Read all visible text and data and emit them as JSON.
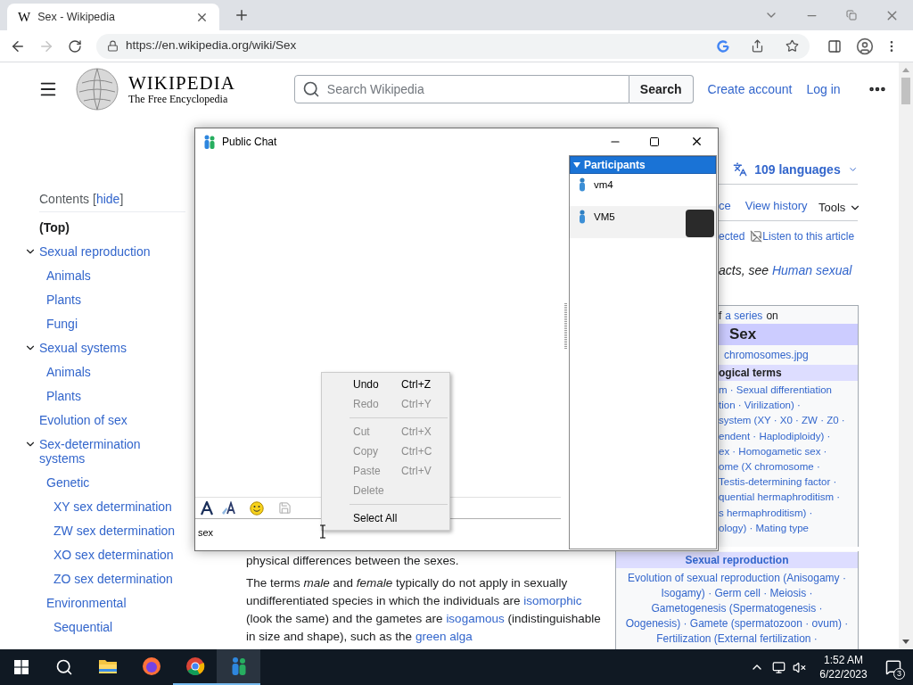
{
  "browser": {
    "tab": {
      "favicon": "W",
      "title": "Sex - Wikipedia",
      "selected": true
    },
    "nav": [
      {
        "kind": "back",
        "disabled": false
      },
      {
        "kind": "forward",
        "disabled": true
      },
      {
        "kind": "reload",
        "disabled": false
      }
    ],
    "url": "https://en.wikipedia.org/wiki/Sex"
  },
  "wiki_header": {
    "wordmark": "WIKIPEDIA",
    "tagline": "The Free Encyclopedia",
    "search_placeholder": "Search Wikipedia",
    "search_button": "Search",
    "links": [
      "Create account",
      "Log in"
    ]
  },
  "toc": {
    "title": "Contents",
    "toggle_open": "[",
    "toggle_label": "hide",
    "toggle_close": "]",
    "items": [
      {
        "label": "(Top)",
        "selected": true
      },
      {
        "label": "Sexual reproduction",
        "selected": false,
        "expanded": true,
        "children": [
          {
            "label": "Animals",
            "selected": false
          },
          {
            "label": "Plants",
            "selected": false
          },
          {
            "label": "Fungi",
            "selected": false
          }
        ]
      },
      {
        "label": "Sexual systems",
        "selected": false,
        "expanded": true,
        "children": [
          {
            "label": "Animals",
            "selected": false
          },
          {
            "label": "Plants",
            "selected": false
          }
        ]
      },
      {
        "label": "Evolution of sex",
        "selected": false
      },
      {
        "label": "Sex-determination systems",
        "selected": false,
        "expanded": true,
        "children": [
          {
            "label": "Genetic",
            "selected": false,
            "children": [
              {
                "label": "XY sex determination",
                "selected": false
              },
              {
                "label": "ZW sex determination",
                "selected": false
              },
              {
                "label": "XO sex determination",
                "selected": false
              },
              {
                "label": "ZO sex determination",
                "selected": false
              }
            ]
          },
          {
            "label": "Environmental",
            "selected": false,
            "children": [
              {
                "label": "Sequential",
                "selected": false
              }
            ]
          }
        ]
      }
    ]
  },
  "page_tools": {
    "languages": "109 languages",
    "tabs": [
      "ce",
      "View history"
    ],
    "tools": "Tools",
    "indicator": "ected",
    "listen": "Listen to this article",
    "hatnote_text": "acts, see ",
    "hatnote_link": "Human sexual"
  },
  "infobox": {
    "series_prefix": "f",
    "series_link": "a series",
    "series_suffix": "on",
    "title": "Sex",
    "image_caption": "chromosomes.jpg",
    "sections": [
      {
        "heading": "ogical terms",
        "lines": [
          "m · Sexual differentiation",
          "tion · Virilization) ·",
          "system (XY · X0 · ZW · Z0 ·",
          "endent · Haplodiploidy) ·",
          "ex · Homogametic sex ·",
          "ome (X chromosome ·",
          "Testis-determining factor ·",
          "quential hermaphroditism ·",
          "s hermaphroditism) ·",
          "ology) · Mating type"
        ]
      },
      {
        "heading": "Sexual reproduction",
        "lines": [
          "Evolution of sexual reproduction (Anisogamy ·",
          "Isogamy) · Germ cell · Meiosis ·",
          "Gametogenesis (Spermatogenesis ·",
          "Oogenesis) · Gamete (spermatozoon · ovum) ·",
          "Fertilization (External fertilization ·"
        ]
      }
    ]
  },
  "article": {
    "paragraphs": [
      [
        {
          "text": "physical differences between the sexes.",
          "link": false
        }
      ],
      [
        {
          "text": "The terms *male* and *female* typically do not apply in sexually undifferentiated species in which the individuals are ",
          "link": false
        },
        {
          "text": "isomorphic",
          "link": true
        },
        {
          "text": " (look the same) and the gametes are ",
          "link": false
        },
        {
          "text": "isogamous",
          "link": true
        },
        {
          "text": " (indistinguishable in size and shape), such as the ",
          "link": false
        },
        {
          "text": "green alga",
          "link": true
        }
      ]
    ]
  },
  "chat": {
    "title": "Public Chat",
    "participants_header": "Participants",
    "participants_expanded": true,
    "participants": [
      {
        "name": "vm4",
        "selected": false,
        "avatar": false
      },
      {
        "name": "VM5",
        "selected": true,
        "avatar": true
      }
    ],
    "toolbar": [
      {
        "kind": "font",
        "disabled": false
      },
      {
        "kind": "color",
        "disabled": false
      },
      {
        "kind": "emoji",
        "disabled": false
      },
      {
        "kind": "save",
        "disabled": true
      }
    ],
    "input_value": "sex",
    "context_menu": [
      {
        "kind": "item",
        "label": "Undo",
        "shortcut": "Ctrl+Z",
        "disabled": false
      },
      {
        "kind": "item",
        "label": "Redo",
        "shortcut": "Ctrl+Y",
        "disabled": true
      },
      {
        "kind": "separator"
      },
      {
        "kind": "item",
        "label": "Cut",
        "shortcut": "Ctrl+X",
        "disabled": true
      },
      {
        "kind": "item",
        "label": "Copy",
        "shortcut": "Ctrl+C",
        "disabled": true
      },
      {
        "kind": "item",
        "label": "Paste",
        "shortcut": "Ctrl+V",
        "disabled": true
      },
      {
        "kind": "item",
        "label": "Delete",
        "disabled": true
      },
      {
        "kind": "separator"
      },
      {
        "kind": "item",
        "label": "Select All",
        "disabled": false
      }
    ]
  },
  "taskbar": {
    "apps": [
      {
        "kind": "explorer",
        "running": false,
        "active": false
      },
      {
        "kind": "firefox",
        "running": false,
        "active": false
      },
      {
        "kind": "chrome",
        "running": true,
        "active": false
      },
      {
        "kind": "chat",
        "running": true,
        "active": true
      }
    ],
    "time": "1:52 AM",
    "date": "6/22/2023",
    "notifications": "3"
  }
}
